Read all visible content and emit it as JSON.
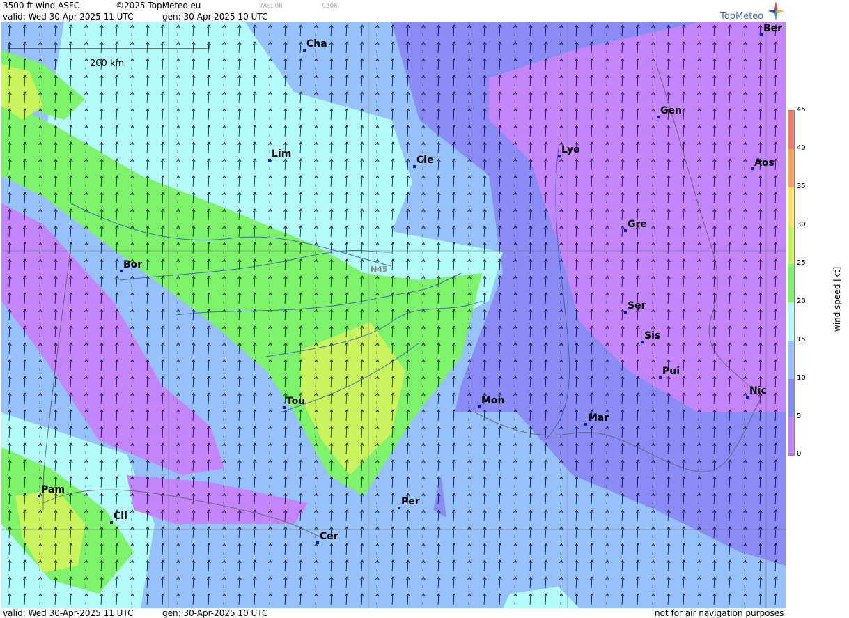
{
  "header": {
    "product": "3500 ft wind ASFC",
    "copyright": "©2025 TopMeteo.eu",
    "day_tab": "Wed 06",
    "code": "9306",
    "valid": "valid:  Wed  30-Apr-2025  11 UTC",
    "generated": "gen: 30-Apr-2025 10 UTC"
  },
  "logo": {
    "text": "TopMeteo",
    "icon": "compass-star-icon"
  },
  "map": {
    "scale_bar_label": "200 km",
    "latitude_label": "N45",
    "cities": [
      {
        "name": "Cha"
      },
      {
        "name": "Lim"
      },
      {
        "name": "Cle"
      },
      {
        "name": "Lyo"
      },
      {
        "name": "Gen"
      },
      {
        "name": "Ber"
      },
      {
        "name": "Aos"
      },
      {
        "name": "Gre"
      },
      {
        "name": "Bor"
      },
      {
        "name": "Ser"
      },
      {
        "name": "Sis"
      },
      {
        "name": "Pui"
      },
      {
        "name": "Tou"
      },
      {
        "name": "Mon"
      },
      {
        "name": "Mar"
      },
      {
        "name": "Nic"
      },
      {
        "name": "Pam"
      },
      {
        "name": "Cil"
      },
      {
        "name": "Per"
      },
      {
        "name": "Cer"
      }
    ],
    "wind_direction": "south (arrows point north)"
  },
  "legend": {
    "title": "wind  speed  [kt]",
    "ticks": [
      "45",
      "40",
      "35",
      "30",
      "25",
      "20",
      "15",
      "10",
      "5",
      "0"
    ],
    "colors": [
      "#f17a6a",
      "#f8a260",
      "#fde16a",
      "#c8f55e",
      "#7df26a",
      "#b4fafa",
      "#97c1fa",
      "#8a8cf5",
      "#c285fa"
    ]
  },
  "footer": {
    "valid": "valid:  Wed  30-Apr-2025  11 UTC",
    "generated": "gen: 30-Apr-2025 10 UTC",
    "disclaimer": "not for air navigation purposes"
  }
}
